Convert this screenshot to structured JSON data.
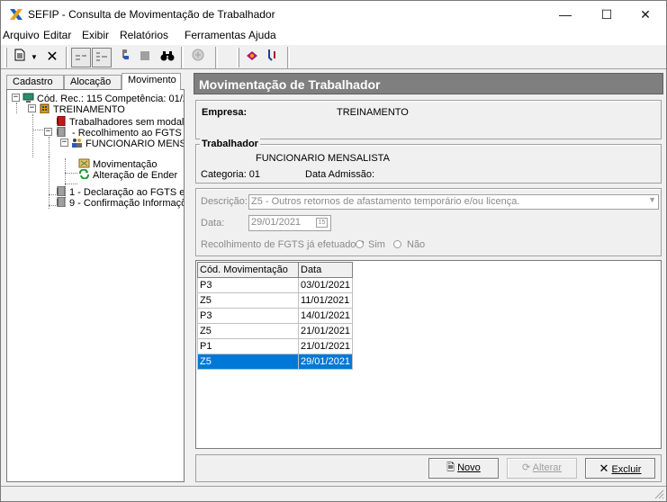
{
  "window": {
    "title": "SEFIP - Consulta de Movimentação de Trabalhador",
    "min_glyph": "—",
    "max_glyph": "☐",
    "close_glyph": "✕"
  },
  "menu": [
    "Arquivo",
    "Editar",
    "Exibir",
    "Relatórios",
    "Ferramentas",
    "Ajuda"
  ],
  "toolbar": {
    "icons": [
      "new-document-icon",
      "dropdown-arrow-icon",
      "delete-icon",
      "list-view-icon",
      "detail-view-icon",
      "tree-icon",
      "stop-icon",
      "binoculars-icon",
      "print-icon",
      "execute-icon",
      "help-icon"
    ]
  },
  "tabs": [
    "Cadastro",
    "Alocação",
    "Movimento"
  ],
  "tree": [
    {
      "label": "Cód. Rec.: 115 Competência: 01/20"
    },
    {
      "label": "TREINAMENTO"
    },
    {
      "label": "Trabalhadores sem modalid"
    },
    {
      "label": " - Recolhimento ao FGTS"
    },
    {
      "label": "FUNCIONARIO MENSA"
    },
    {
      "label": "Movimentação"
    },
    {
      "label": "Alteração de Ender"
    },
    {
      "label": "1 - Declaração ao FGTS e ."
    },
    {
      "label": "9 - Confirmação Informaçõe"
    }
  ],
  "panel": {
    "header": "Movimentação de Trabalhador",
    "empresa_label": "Empresa:",
    "empresa_value": "TREINAMENTO",
    "trabalhador_title": "Trabalhador",
    "trabalhador_name": "FUNCIONARIO MENSALISTA",
    "categoria_label": "Categoria: 01",
    "admissao_label": "Data Admissão:",
    "descricao_label": "Descrição:",
    "descricao_value": "Z5 - Outros retornos de afastamento temporário e/ou licença.",
    "data_label": "Data:",
    "data_value": "29/01/2021",
    "recolhimento_label": "Recolhimento de FGTS já efetuado ?",
    "sim_label": "Sim",
    "nao_label": "Não"
  },
  "grid": {
    "columns": [
      "Cód. Movimentação",
      "Data"
    ],
    "rows": [
      [
        "P3",
        "03/01/2021"
      ],
      [
        "Z5",
        "11/01/2021"
      ],
      [
        "P3",
        "14/01/2021"
      ],
      [
        "Z5",
        "21/01/2021"
      ],
      [
        "P1",
        "21/01/2021"
      ],
      [
        "Z5",
        "29/01/2021"
      ]
    ],
    "selected_row": 5
  },
  "buttons": {
    "novo": "Novo",
    "alterar": "Alterar",
    "excluir": "Excluir"
  },
  "colors": {
    "selection": "#0078d7",
    "header_bg": "#7f7f7f"
  }
}
